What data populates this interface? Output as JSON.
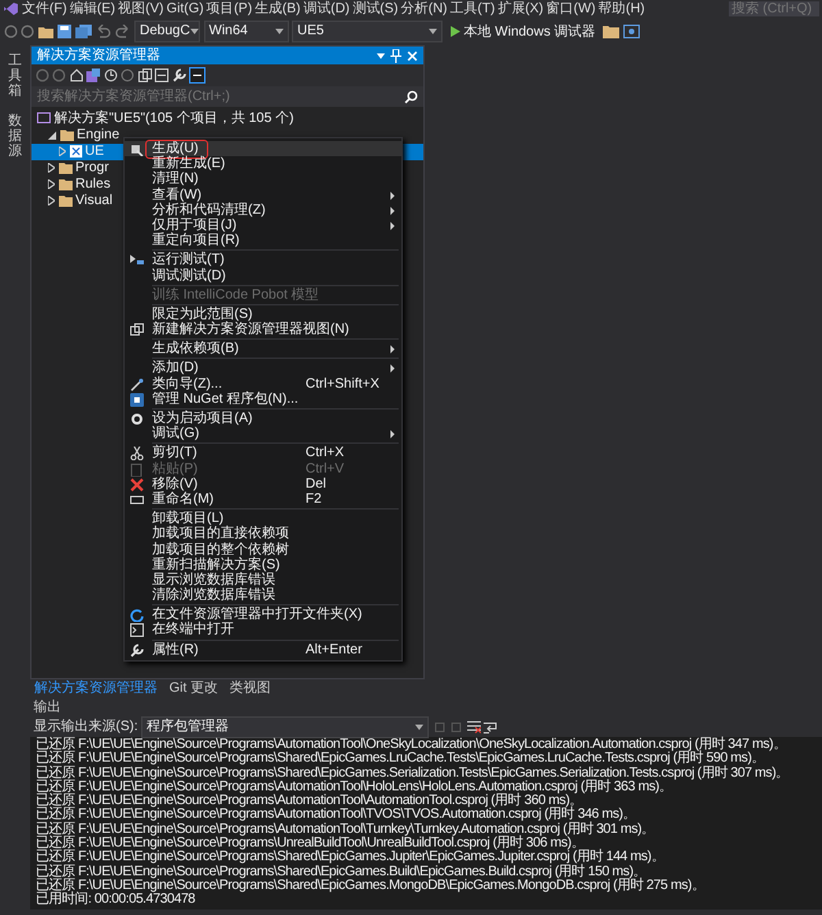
{
  "menu_bar": {
    "items": [
      "文件(F)",
      "编辑(E)",
      "视图(V)",
      "Git(G)",
      "项目(P)",
      "生成(B)",
      "调试(D)",
      "测试(S)",
      "分析(N)",
      "工具(T)",
      "扩展(X)",
      "窗口(W)",
      "帮助(H)"
    ],
    "search": {
      "placeholder": "搜索 (Ctrl+Q)"
    }
  },
  "toolbar": {
    "configuration": "DebugC",
    "platform": "Win64",
    "project": "UE5",
    "run_button": "本地 Windows 调试器"
  },
  "side_tabs": [
    "工具箱",
    "数据源"
  ],
  "solution_explorer": {
    "title": "解决方案资源管理器",
    "search": {
      "placeholder": "搜索解决方案资源管理器(Ctrl+;)"
    },
    "tree": [
      {
        "label": "解决方案\"UE5\"(105 个项目，共 105 个)",
        "kind": "solution",
        "selected": false,
        "children": [
          {
            "label": "Engine",
            "kind": "folder",
            "expanded": true,
            "selected": false,
            "children": [
              {
                "label": "UE",
                "kind": "project",
                "expanded": false,
                "selected": true
              }
            ]
          },
          {
            "label": "Progr",
            "kind": "folder",
            "expanded": false,
            "selected": false
          },
          {
            "label": "Rules",
            "kind": "folder",
            "expanded": false,
            "selected": false
          },
          {
            "label": "Visual",
            "kind": "folder",
            "expanded": false,
            "selected": false
          }
        ]
      }
    ]
  },
  "context_menu": [
    {
      "kind": "item",
      "label": "生成(U)",
      "highlighted": true,
      "annotated": true
    },
    {
      "kind": "item",
      "label": "重新生成(E)"
    },
    {
      "kind": "item",
      "label": "清理(N)"
    },
    {
      "kind": "item",
      "label": "查看(W)",
      "submenu": true
    },
    {
      "kind": "item",
      "label": "分析和代码清理(Z)",
      "submenu": true
    },
    {
      "kind": "item",
      "label": "仅用于项目(J)",
      "submenu": true
    },
    {
      "kind": "item",
      "label": "重定向项目(R)"
    },
    {
      "kind": "separator"
    },
    {
      "kind": "item",
      "label": "运行测试(T)"
    },
    {
      "kind": "item",
      "label": "调试测试(D)"
    },
    {
      "kind": "separator"
    },
    {
      "kind": "item",
      "label": "训练 IntelliCode Pobot 模型",
      "disabled": true
    },
    {
      "kind": "separator"
    },
    {
      "kind": "item",
      "label": "限定为此范围(S)"
    },
    {
      "kind": "item",
      "label": "新建解决方案资源管理器视图(N)"
    },
    {
      "kind": "separator"
    },
    {
      "kind": "item",
      "label": "生成依赖项(B)",
      "submenu": true
    },
    {
      "kind": "separator"
    },
    {
      "kind": "item",
      "label": "添加(D)",
      "submenu": true
    },
    {
      "kind": "item",
      "label": "类向导(Z)...",
      "shortcut": "Ctrl+Shift+X"
    },
    {
      "kind": "item",
      "label": "管理 NuGet 程序包(N)..."
    },
    {
      "kind": "separator"
    },
    {
      "kind": "item",
      "label": "设为启动项目(A)"
    },
    {
      "kind": "item",
      "label": "调试(G)",
      "submenu": true
    },
    {
      "kind": "separator"
    },
    {
      "kind": "item",
      "label": "剪切(T)",
      "shortcut": "Ctrl+X"
    },
    {
      "kind": "item",
      "label": "粘贴(P)",
      "shortcut": "Ctrl+V",
      "disabled": true
    },
    {
      "kind": "item",
      "label": "移除(V)",
      "shortcut": "Del"
    },
    {
      "kind": "item",
      "label": "重命名(M)",
      "shortcut": "F2"
    },
    {
      "kind": "separator"
    },
    {
      "kind": "item",
      "label": "卸载项目(L)"
    },
    {
      "kind": "item",
      "label": "加载项目的直接依赖项"
    },
    {
      "kind": "item",
      "label": "加载项目的整个依赖树"
    },
    {
      "kind": "item",
      "label": "重新扫描解决方案(S)"
    },
    {
      "kind": "item",
      "label": "显示浏览数据库错误"
    },
    {
      "kind": "item",
      "label": "清除浏览数据库错误"
    },
    {
      "kind": "separator"
    },
    {
      "kind": "item",
      "label": "在文件资源管理器中打开文件夹(X)"
    },
    {
      "kind": "item",
      "label": "在终端中打开"
    },
    {
      "kind": "separator"
    },
    {
      "kind": "item",
      "label": "属性(R)",
      "shortcut": "Alt+Enter"
    }
  ],
  "bottom_tabs": [
    {
      "label": "解决方案资源管理器",
      "selected": true
    },
    {
      "label": "Git 更改",
      "selected": false
    },
    {
      "label": "类视图",
      "selected": false
    }
  ],
  "output": {
    "title": "输出",
    "source_label": "显示输出来源(S):",
    "source": "程序包管理器",
    "lines": [
      "已还原 F:\\UE\\UE\\Engine\\Source\\Programs\\AutomationTool\\OneSkyLocalization\\OneSkyLocalization.Automation.csproj (用时 347 ms)。",
      "已还原 F:\\UE\\UE\\Engine\\Source\\Programs\\Shared\\EpicGames.LruCache.Tests\\EpicGames.LruCache.Tests.csproj (用时 590 ms)。",
      "已还原 F:\\UE\\UE\\Engine\\Source\\Programs\\Shared\\EpicGames.Serialization.Tests\\EpicGames.Serialization.Tests.csproj (用时 307 ms)。",
      "已还原 F:\\UE\\UE\\Engine\\Source\\Programs\\AutomationTool\\HoloLens\\HoloLens.Automation.csproj (用时 363 ms)。",
      "已还原 F:\\UE\\UE\\Engine\\Source\\Programs\\AutomationTool\\AutomationTool.csproj (用时 360 ms)。",
      "已还原 F:\\UE\\UE\\Engine\\Source\\Programs\\AutomationTool\\TVOS\\TVOS.Automation.csproj (用时 346 ms)。",
      "已还原 F:\\UE\\UE\\Engine\\Source\\Programs\\AutomationTool\\Turnkey\\Turnkey.Automation.csproj (用时 301 ms)。",
      "已还原 F:\\UE\\UE\\Engine\\Source\\Programs\\UnrealBuildTool\\UnrealBuildTool.csproj (用时 306 ms)。",
      "已还原 F:\\UE\\UE\\Engine\\Source\\Programs\\Shared\\EpicGames.Jupiter\\EpicGames.Jupiter.csproj (用时 144 ms)。",
      "已还原 F:\\UE\\UE\\Engine\\Source\\Programs\\Shared\\EpicGames.Build\\EpicGames.Build.csproj (用时 150 ms)。",
      "已还原 F:\\UE\\UE\\Engine\\Source\\Programs\\Shared\\EpicGames.MongoDB\\EpicGames.MongoDB.csproj (用时 275 ms)。",
      "已用时间: 00:00:05.4730478"
    ]
  }
}
